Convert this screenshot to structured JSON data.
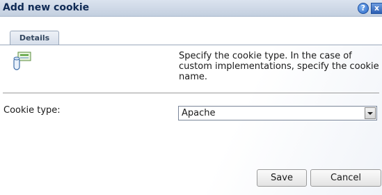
{
  "dialog": {
    "title": "Add new cookie",
    "help_icon": "help-icon",
    "help_glyph": "?",
    "close_icon": "close-icon",
    "close_glyph": "x"
  },
  "tabs": [
    {
      "label": "Details",
      "active": true
    }
  ],
  "header": {
    "icon": "cookie-database-icon",
    "description": "Specify the cookie type. In the case of custom implementations, specify the cookie name."
  },
  "form": {
    "cookie_type": {
      "label": "Cookie type:",
      "value": "Apache"
    }
  },
  "buttons": {
    "save": "Save",
    "cancel": "Cancel"
  },
  "colors": {
    "title_text": "#0f2a55",
    "accent_blue": "#2a68c8"
  }
}
